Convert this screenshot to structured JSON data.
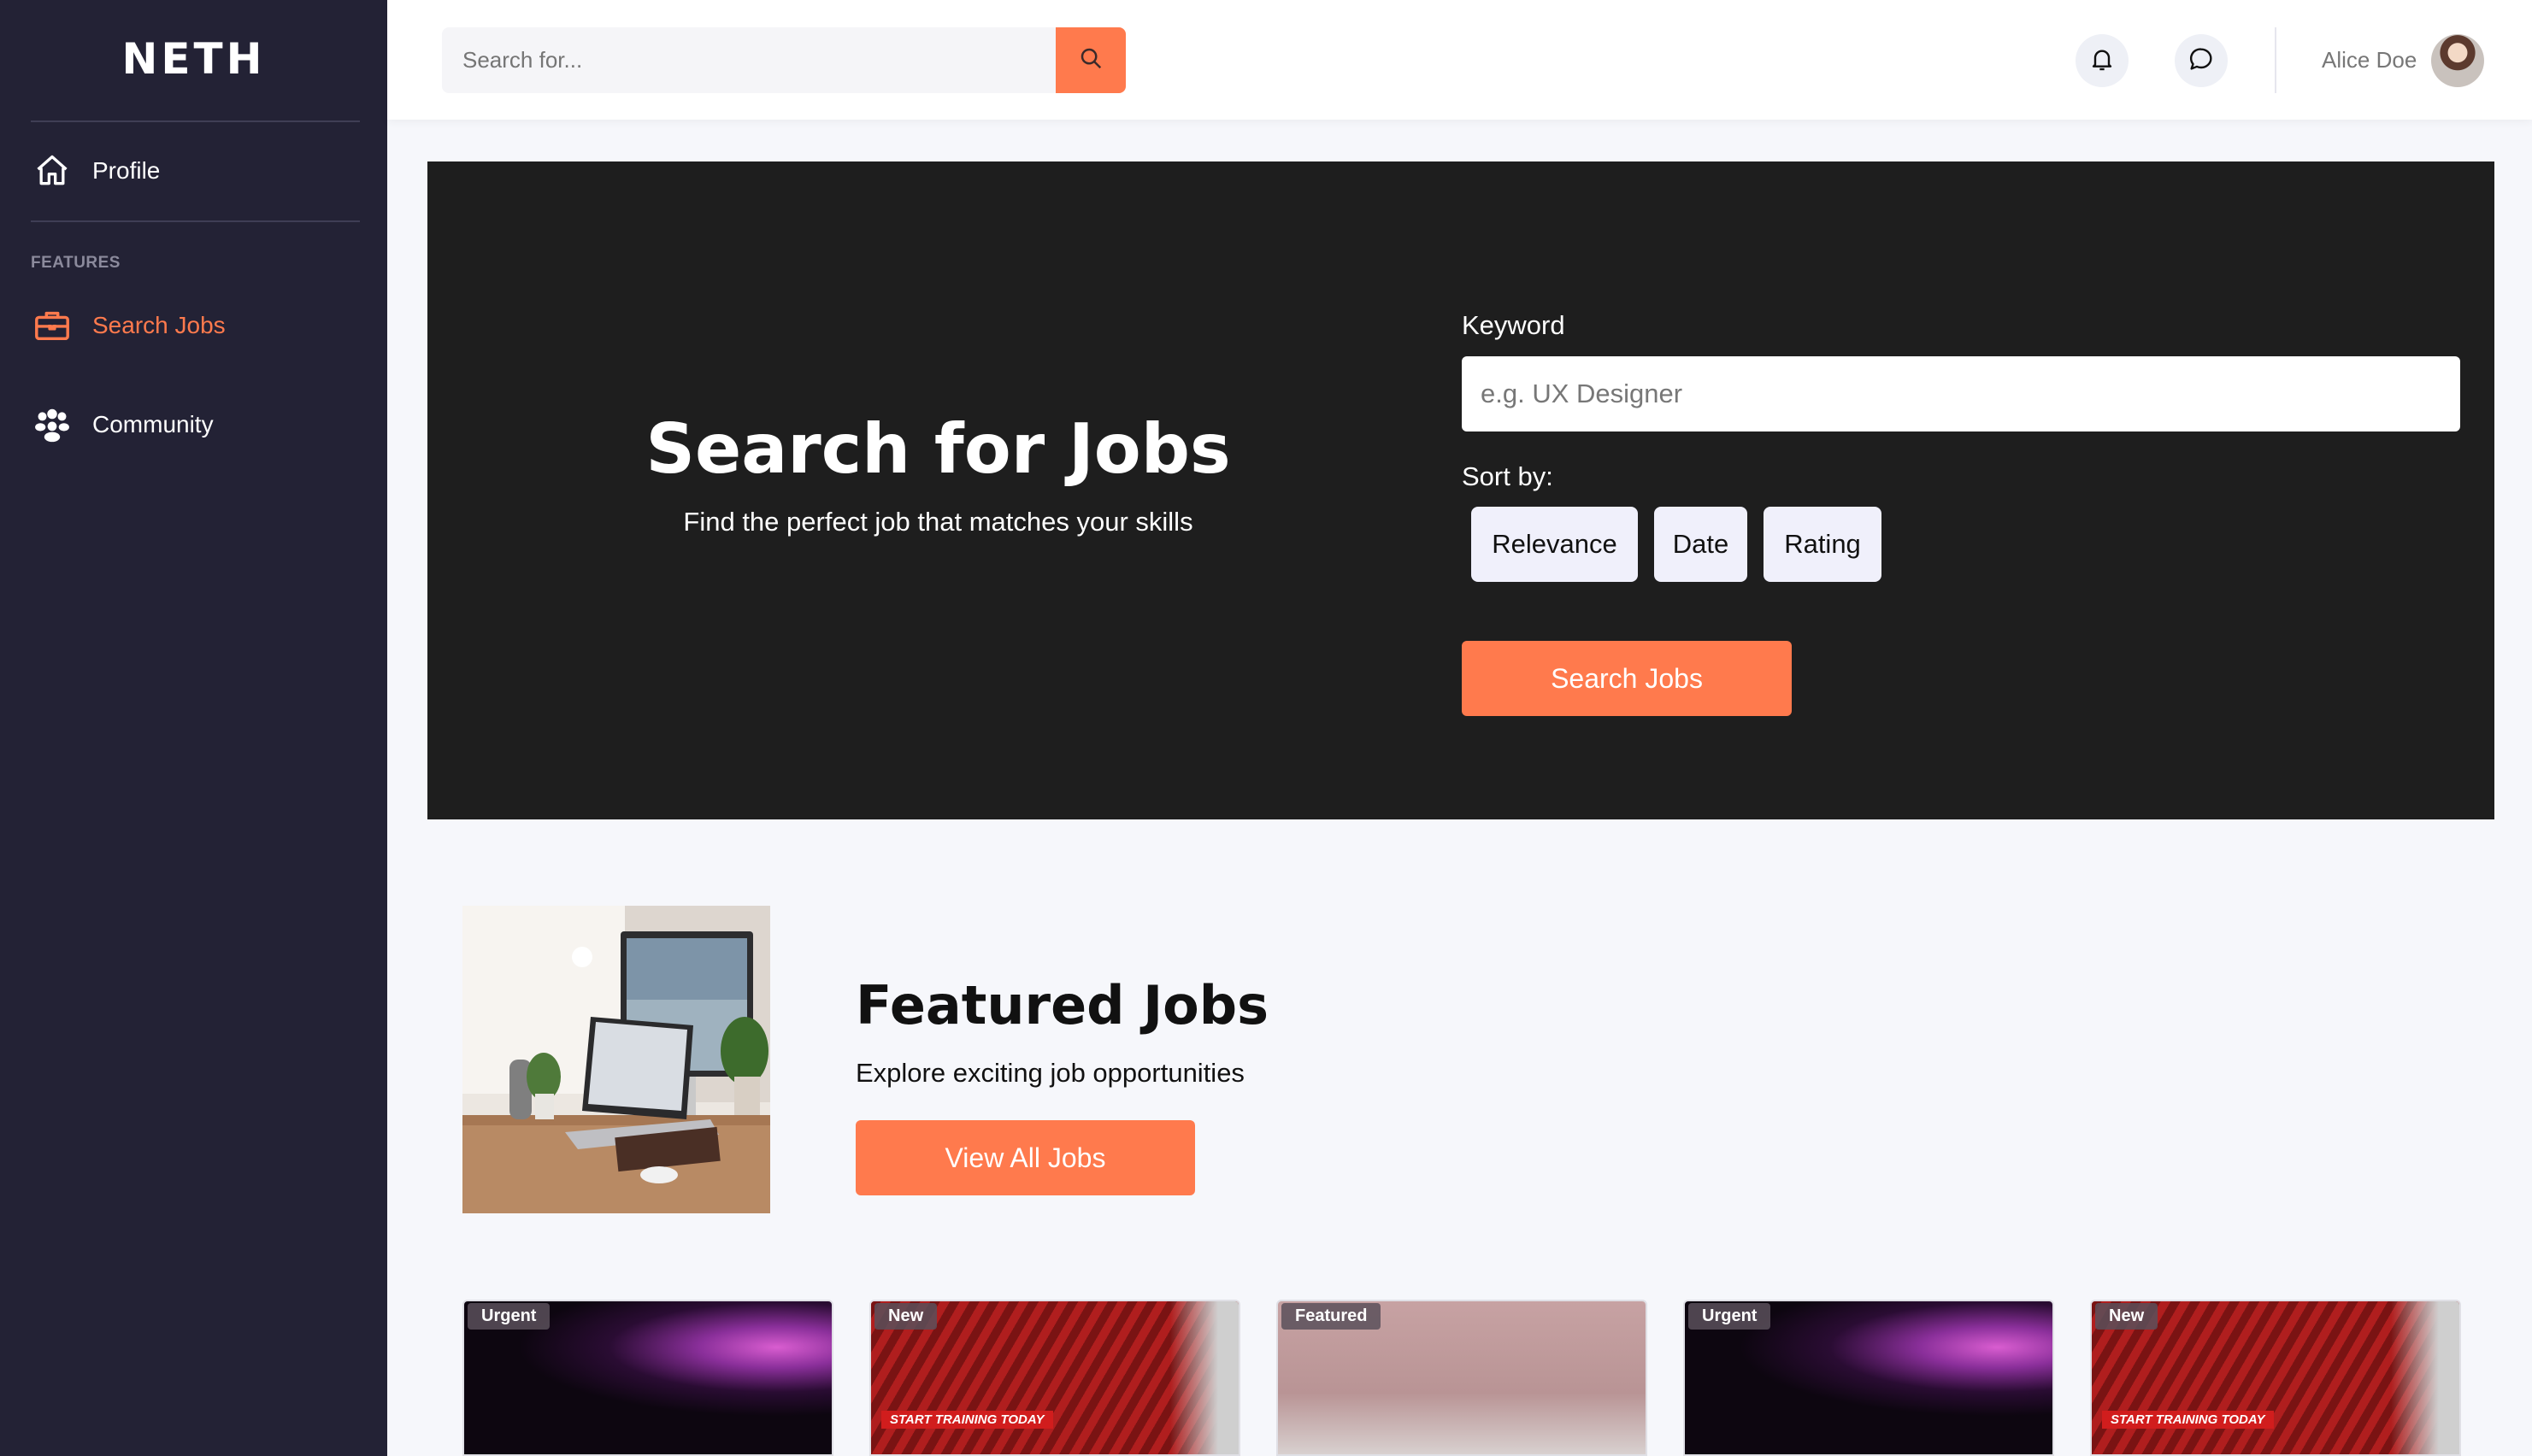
{
  "sidebar": {
    "brand": "NETH",
    "items": [
      {
        "label": "Profile"
      },
      {
        "label": "Search Jobs"
      },
      {
        "label": "Community"
      }
    ],
    "section_label": "FEATURES"
  },
  "header": {
    "search_placeholder": "Search for...",
    "user_name": "Alice Doe"
  },
  "hero": {
    "title": "Search for Jobs",
    "subtitle": "Find the perfect job that matches your skills",
    "keyword_label": "Keyword",
    "keyword_placeholder": "e.g. UX Designer",
    "sort_label": "Sort by:",
    "sort_options": [
      "Relevance",
      "Date",
      "Rating"
    ],
    "search_button": "Search Jobs"
  },
  "featured": {
    "title": "Featured Jobs",
    "subtitle": "Explore exciting job opportunities",
    "button": "View All Jobs"
  },
  "job_cards": [
    {
      "badge": "Urgent"
    },
    {
      "badge": "New",
      "caption": "START TRAINING TODAY"
    },
    {
      "badge": "Featured"
    },
    {
      "badge": "Urgent"
    },
    {
      "badge": "New",
      "caption": "START TRAINING TODAY"
    }
  ],
  "colors": {
    "accent": "#ff7a4d",
    "sidebar_bg": "#232235",
    "hero_bg": "#1e1e1e",
    "page_bg": "#f6f7fb"
  },
  "icons": {
    "profile": "home-icon",
    "search_jobs": "briefcase-icon",
    "community": "users-icon",
    "search": "search-icon",
    "notifications": "bell-icon",
    "messages": "chat-icon"
  }
}
